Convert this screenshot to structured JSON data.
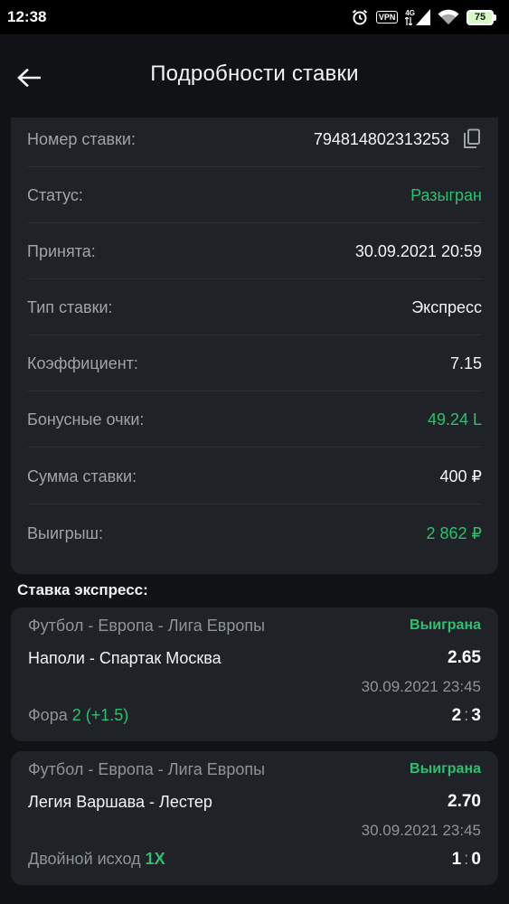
{
  "status_bar": {
    "time": "12:38",
    "vpn_label": "VPN",
    "network_label": "4G",
    "battery_level": "75",
    "icons": [
      "alarm-icon",
      "vpn-icon",
      "signal-icon",
      "wifi-icon",
      "battery-icon"
    ]
  },
  "header": {
    "back_icon": "arrow-left-icon",
    "title": "Подробности ставки"
  },
  "details": {
    "bet_number": {
      "label": "Номер ставки:",
      "value": "794814802313253"
    },
    "status": {
      "label": "Статус:",
      "value": "Разыгран"
    },
    "accepted": {
      "label": "Принята:",
      "value": "30.09.2021 20:59"
    },
    "bet_type": {
      "label": "Тип ставки:",
      "value": "Экспресс"
    },
    "coefficient": {
      "label": "Коэффициент:",
      "value": "7.15"
    },
    "bonus_points": {
      "label": "Бонусные очки:",
      "value": "49.24 L"
    },
    "stake": {
      "label": "Сумма ставки:",
      "value": "400 ₽"
    },
    "winnings": {
      "label": "Выигрыш:",
      "value": "2 862 ₽"
    }
  },
  "express": {
    "title": "Ставка экспресс:",
    "events": [
      {
        "league": "Футбол - Европа - Лига Европы",
        "status": "Выиграна",
        "match": "Наполи - Спартак Москва",
        "odds": "2.65",
        "datetime": "30.09.2021 23:45",
        "market": "Фора",
        "pick": "2 (+1.5)",
        "score_home": "2",
        "score_sep": ":",
        "score_away": "3"
      },
      {
        "league": "Футбол - Европа - Лига Европы",
        "status": "Выиграна",
        "match": "Легия Варшава - Лестер",
        "odds": "2.70",
        "datetime": "30.09.2021 23:45",
        "market": "Двойной исход",
        "pick": "1X",
        "score_home": "1",
        "score_sep": ":",
        "score_away": "0"
      }
    ]
  },
  "colors": {
    "background": "#101216",
    "card": "#1f2227",
    "accent_green": "#2fbf71",
    "muted_text": "#8f939a"
  }
}
